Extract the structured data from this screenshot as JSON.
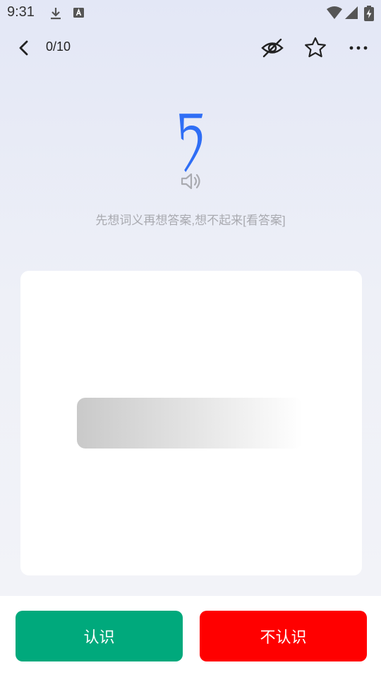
{
  "status_bar": {
    "time": "9:31",
    "icons": [
      "download-icon",
      "keyboard-a-icon",
      "wifi-icon",
      "signal-icon",
      "battery-charging-icon"
    ]
  },
  "top_bar": {
    "progress": "0/10",
    "icons": [
      "back-chevron-icon",
      "eye-off-icon",
      "star-icon",
      "more-horizontal-icon"
    ]
  },
  "word": {
    "text": "ཏ",
    "color": "#2f6ef5"
  },
  "speaker_icon": "speaker-icon",
  "hint": "先想词义再想答案,想不起来[看答案]",
  "buttons": {
    "know": "认识",
    "unknown": "不认识",
    "know_color": "#00a97c",
    "unknown_color": "#ff0000"
  }
}
